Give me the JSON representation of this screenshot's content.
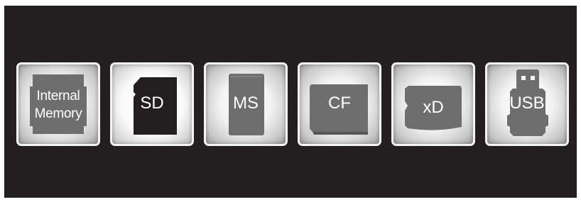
{
  "screen": {
    "colors": {
      "background": "#231f20",
      "card_fill": "#6e6e6e",
      "card_fill_selected": "#231f20",
      "label": "#ffffff"
    },
    "selected_source": "SD",
    "sources": [
      {
        "id": "internal-memory",
        "icon": "internal-memory-icon",
        "label_line1": "Internal",
        "label_line2": "Memory"
      },
      {
        "id": "sd",
        "icon": "sd-card-icon",
        "label": "SD"
      },
      {
        "id": "ms",
        "icon": "memory-stick-icon",
        "label": "MS"
      },
      {
        "id": "cf",
        "icon": "compactflash-card-icon",
        "label": "CF"
      },
      {
        "id": "xd",
        "icon": "xd-card-icon",
        "label": "xD"
      },
      {
        "id": "usb",
        "icon": "usb-drive-icon",
        "label": "USB"
      }
    ]
  }
}
